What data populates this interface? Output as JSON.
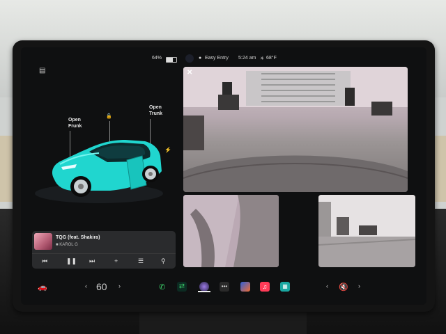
{
  "status": {
    "battery": "64%",
    "mode": "Easy Entry",
    "time": "5:24 am",
    "temp": "68°F"
  },
  "car": {
    "frunk_label": "Open\nFrunk",
    "trunk_label": "Open\nTrunk",
    "paint_color": "#20d6cf"
  },
  "media": {
    "title": "TQG (feat. Shakira)",
    "artist": "KAROL G"
  },
  "dock": {
    "speed_value": "60"
  },
  "colors": {
    "accent_teal": "#20d6cf",
    "phone_green": "#3ccf6a",
    "music_red": "#ff3b57",
    "camera_border": "#000000"
  },
  "icons": {
    "side": "sidebar-toggle-icon",
    "cam_close": "close-icon"
  }
}
